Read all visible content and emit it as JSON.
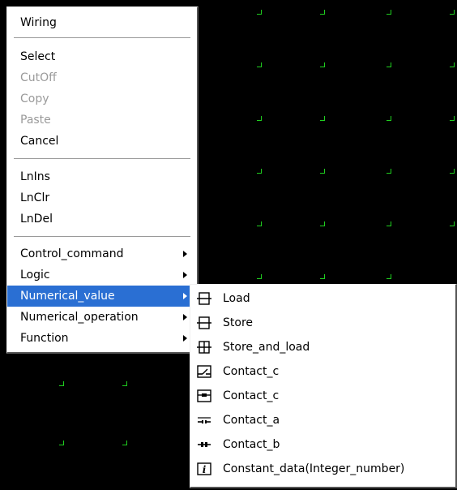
{
  "colors": {
    "background": "#000000",
    "grid_mark": "#1fce1f",
    "highlight": "#2a6fd3",
    "disabled": "#9a9a9a"
  },
  "context_menu": {
    "items": [
      {
        "label": "Wiring"
      },
      {
        "label": "Select"
      },
      {
        "label": "CutOff",
        "disabled": true
      },
      {
        "label": "Copy",
        "disabled": true
      },
      {
        "label": "Paste",
        "disabled": true
      },
      {
        "label": "Cancel"
      },
      {
        "label": "LnIns"
      },
      {
        "label": "LnClr"
      },
      {
        "label": "LnDel"
      },
      {
        "label": "Control_command",
        "submenu": true
      },
      {
        "label": "Logic",
        "submenu": true
      },
      {
        "label": "Numerical_value",
        "submenu": true,
        "highlighted": true
      },
      {
        "label": "Numerical_operation",
        "submenu": true
      },
      {
        "label": "Function",
        "submenu": true
      }
    ]
  },
  "submenu": {
    "items": [
      {
        "label": "Load",
        "icon": "load-icon"
      },
      {
        "label": "Store",
        "icon": "store-icon"
      },
      {
        "label": "Store_and_load",
        "icon": "store-and-load-icon"
      },
      {
        "label": "Contact_c",
        "icon": "contact-c-icon"
      },
      {
        "label": "Contact_c",
        "icon": "contact-c-alt-icon"
      },
      {
        "label": "Contact_a",
        "icon": "contact-a-icon"
      },
      {
        "label": "Contact_b",
        "icon": "contact-b-icon"
      },
      {
        "label": "Constant_data(Integer_number)",
        "icon": "constant-data-icon"
      }
    ]
  }
}
